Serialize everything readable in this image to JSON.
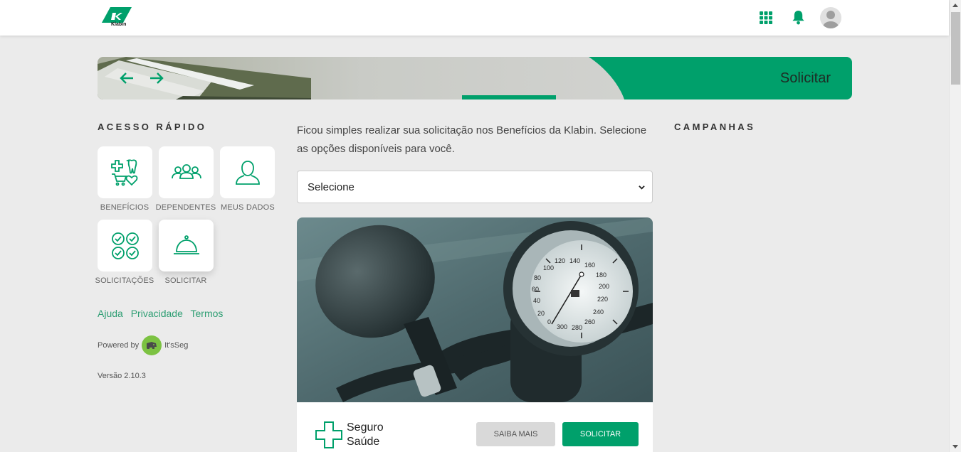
{
  "header": {
    "logo_text": "Klabin",
    "icons": [
      "apps-grid-icon",
      "bell-icon",
      "user-avatar-icon"
    ]
  },
  "banner": {
    "cta": "Solicitar"
  },
  "quick_access": {
    "title": "ACESSO RÁPIDO",
    "items": [
      {
        "label": "BENEFÍCIOS",
        "icon": "benefits-icon"
      },
      {
        "label": "DEPENDENTES",
        "icon": "dependents-icon"
      },
      {
        "label": "MEUS DADOS",
        "icon": "user-icon"
      },
      {
        "label": "SOLICITAÇÕES",
        "icon": "checklist-icon"
      },
      {
        "label": "SOLICITAR",
        "icon": "service-bell-icon"
      }
    ]
  },
  "footer": {
    "links": [
      "Ajuda",
      "Privacidade",
      "Termos"
    ],
    "powered_by": "Powered by",
    "brand": "It'sSeg",
    "version": "Versão 2.10.3"
  },
  "main": {
    "intro": "Ficou simples realizar sua solicitação nos Benefícios da Klabin. Selecione as opções disponíveis para você.",
    "select": {
      "value": "Selecione"
    },
    "card": {
      "title_line1": "Seguro",
      "title_line2": "Saúde",
      "more_label": "SAIBA MAIS",
      "request_label": "SOLICITAR"
    }
  },
  "campaigns": {
    "title": "CAMPANHAS"
  },
  "colors": {
    "accent": "#00a06b",
    "link": "#2e9e73",
    "background": "#ebebeb"
  }
}
